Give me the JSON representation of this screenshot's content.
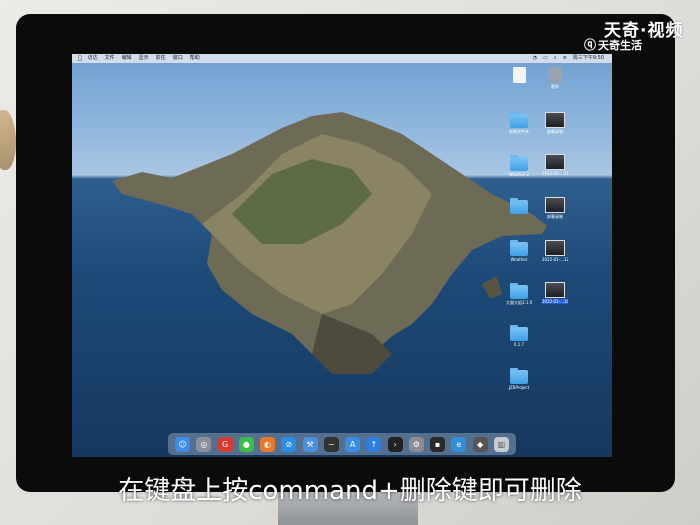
{
  "watermark": {
    "brand": "天奇·视频",
    "sub": "天奇生活",
    "sub_icon": "q-circle-icon"
  },
  "menubar": {
    "apple_icon": "apple-icon",
    "items": [
      "访达",
      "文件",
      "编辑",
      "显示",
      "前往",
      "窗口",
      "帮助"
    ],
    "clock": "周三下午9:50"
  },
  "desktop_icons": [
    {
      "label": "",
      "kind": "doc"
    },
    {
      "label": "截屏",
      "kind": "doc"
    },
    {
      "label": "新建文件夹",
      "kind": "folder"
    },
    {
      "label": "屏幕录制",
      "kind": "thumb"
    },
    {
      "label": "Weather 2",
      "kind": "folder"
    },
    {
      "label": "2022-01-...11.mov",
      "kind": "thumb"
    },
    {
      "label": "",
      "kind": "folder"
    },
    {
      "label": "屏幕录制",
      "kind": "thumb"
    },
    {
      "label": "Weather",
      "kind": "folder"
    },
    {
      "label": "2022-01-...12.mov",
      "kind": "thumb"
    },
    {
      "label": "大量大姐3.1.0",
      "kind": "folder"
    },
    {
      "label": "2022-01-...10.mov",
      "kind": "thumb",
      "selected": true
    },
    {
      "label": "0.1.7",
      "kind": "folder"
    },
    {
      "label": "JZBProject",
      "kind": "folder"
    }
  ],
  "dock_apps": [
    {
      "icon": "finder-icon",
      "color": "#3f8be8"
    },
    {
      "icon": "launchpad-icon",
      "color": "#8a8f99"
    },
    {
      "icon": "netease-icon",
      "color": "#d83a2f"
    },
    {
      "icon": "wechat-icon",
      "color": "#3bbd4a"
    },
    {
      "icon": "firefox-icon",
      "color": "#e8772a"
    },
    {
      "icon": "safari-icon",
      "color": "#2b8ee6"
    },
    {
      "icon": "xcode-icon",
      "color": "#4a8fe0"
    },
    {
      "icon": "stocks-icon",
      "color": "#333333"
    },
    {
      "icon": "appstore-icon",
      "color": "#3a8ee8"
    },
    {
      "icon": "arrow-up-icon",
      "color": "#2f7ddc"
    },
    {
      "icon": "terminal-icon",
      "color": "#222222"
    },
    {
      "icon": "settings-icon",
      "color": "#8a8d92"
    },
    {
      "icon": "activity-icon",
      "color": "#2a2a2a"
    },
    {
      "icon": "edge-icon",
      "color": "#2f8fd8"
    },
    {
      "icon": "drop-icon",
      "color": "#555555"
    },
    {
      "icon": "trash-icon",
      "color": "#c7ccd2"
    }
  ],
  "caption": "在键盘上按command+删除键即可删除"
}
